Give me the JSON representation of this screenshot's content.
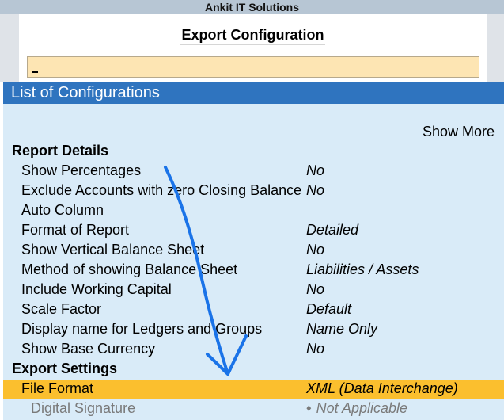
{
  "app": {
    "company": "Ankit IT Solutions"
  },
  "header": {
    "title": "Export Configuration",
    "input_value": ""
  },
  "list": {
    "title": "List of Configurations",
    "show_more": "Show More",
    "sections": [
      {
        "title": "Report Details",
        "rows": [
          {
            "label": "Show Percentages",
            "value": "No"
          },
          {
            "label": "Exclude Accounts with zero Closing Balance",
            "value": "No"
          },
          {
            "label": "Auto Column",
            "value": ""
          },
          {
            "label": "Format of Report",
            "value": "Detailed"
          },
          {
            "label": "Show Vertical Balance Sheet",
            "value": "No"
          },
          {
            "label": "Method of showing Balance Sheet",
            "value": "Liabilities / Assets"
          },
          {
            "label": "Include Working Capital",
            "value": "No"
          },
          {
            "label": "Scale Factor",
            "value": "Default"
          },
          {
            "label": "Display name for Ledgers and Groups",
            "value": "Name Only"
          },
          {
            "label": "Show Base Currency",
            "value": "No"
          }
        ]
      },
      {
        "title": "Export Settings",
        "rows": [
          {
            "label": "File Format",
            "value": "XML (Data Interchange)",
            "selected": true
          },
          {
            "label": "Digital Signature",
            "value": "Not Applicable",
            "disabled": true
          }
        ]
      }
    ]
  },
  "colors": {
    "title_bar": "#2f74bf",
    "panel_bg": "#d9ebf8",
    "highlight": "#fbbf2e",
    "input_bg": "#fde5b3",
    "annotation_arrow": "#1a73e8"
  },
  "icons": {
    "disabled_marker": "diamond-icon"
  }
}
